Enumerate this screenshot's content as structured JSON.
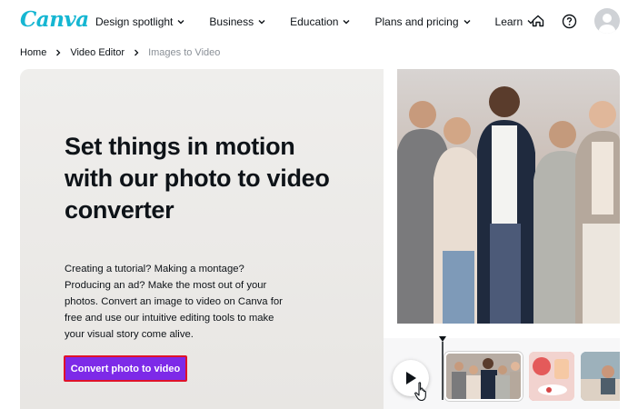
{
  "logo": {
    "text": "Canva"
  },
  "nav": {
    "items": [
      {
        "label": "Design spotlight"
      },
      {
        "label": "Business"
      },
      {
        "label": "Education"
      },
      {
        "label": "Plans and pricing"
      },
      {
        "label": "Learn"
      }
    ],
    "icons": [
      "home-icon",
      "help-icon",
      "avatar"
    ]
  },
  "breadcrumb": {
    "items": [
      {
        "label": "Home"
      },
      {
        "label": "Video Editor"
      },
      {
        "label": "Images to Video"
      }
    ]
  },
  "hero": {
    "title": "Set things in motion with our photo to video converter",
    "description": "Creating a tutorial? Making a montage? Producing an ad? Make the most out of your photos. Convert an image to video on Canva for free and use our intuitive editing tools to make your visual story come alive.",
    "cta_label": "Convert photo to video"
  },
  "colors": {
    "brand": "#16b6d2",
    "cta": "#7d2ae8",
    "cta_outline": "#e0122a",
    "hero_bg": "#efeeec"
  },
  "timeline": {
    "icons": [
      "play-icon",
      "hand-cursor-icon"
    ]
  }
}
